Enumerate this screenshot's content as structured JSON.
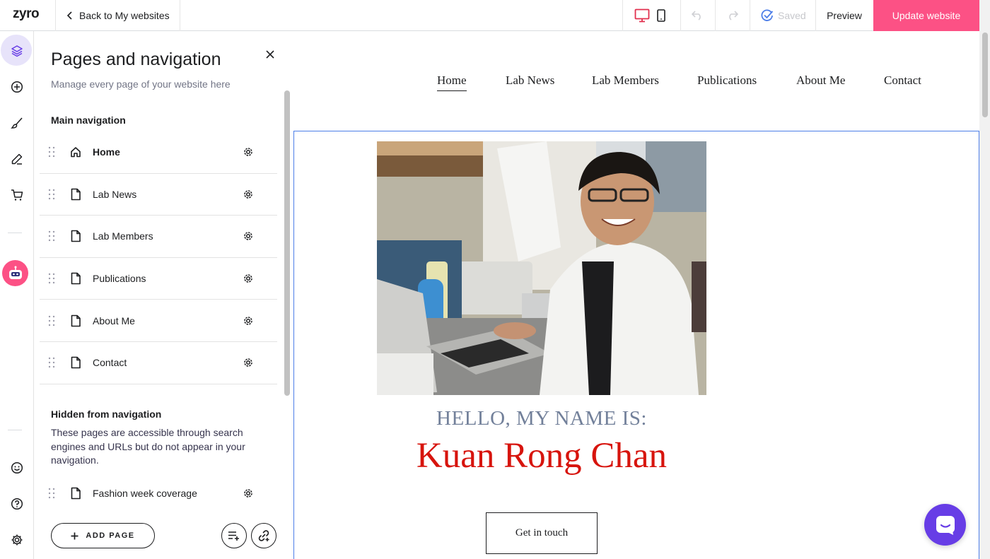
{
  "topbar": {
    "logo": "zyro",
    "back_label": "Back to My websites",
    "saved_label": "Saved",
    "preview_label": "Preview",
    "update_label": "Update website",
    "accent": "#fc5185"
  },
  "rail": {
    "icons": [
      "layers-icon",
      "plus-circle-icon",
      "brush-icon",
      "pen-icon",
      "cart-icon",
      "robot-icon",
      "smile-icon",
      "help-icon",
      "settings-icon"
    ]
  },
  "panel": {
    "title": "Pages and navigation",
    "subtitle": "Manage every page of your website here",
    "main_heading": "Main navigation",
    "pages": [
      {
        "label": "Home",
        "icon": "home-icon"
      },
      {
        "label": "Lab News",
        "icon": "page-icon"
      },
      {
        "label": "Lab Members",
        "icon": "page-icon"
      },
      {
        "label": "Publications",
        "icon": "page-icon"
      },
      {
        "label": "About Me",
        "icon": "page-icon"
      },
      {
        "label": "Contact",
        "icon": "page-icon"
      }
    ],
    "hidden_heading": "Hidden from navigation",
    "hidden_desc": "These pages are accessible through search engines and URLs but do not appear in your navigation.",
    "hidden_pages": [
      {
        "label": "Fashion week coverage",
        "icon": "page-icon"
      }
    ],
    "add_page_label": "ADD PAGE"
  },
  "site": {
    "nav": [
      "Home",
      "Lab News",
      "Lab Members",
      "Publications",
      "About Me",
      "Contact"
    ],
    "active_nav": "Home",
    "hello": "HELLO, MY NAME IS:",
    "name": "Kuan Rong Chan",
    "cta": "Get in touch",
    "name_color": "#d7140d",
    "hello_color": "#72809a",
    "selection_color": "#4d7ee8",
    "chat_color": "#673de6"
  }
}
